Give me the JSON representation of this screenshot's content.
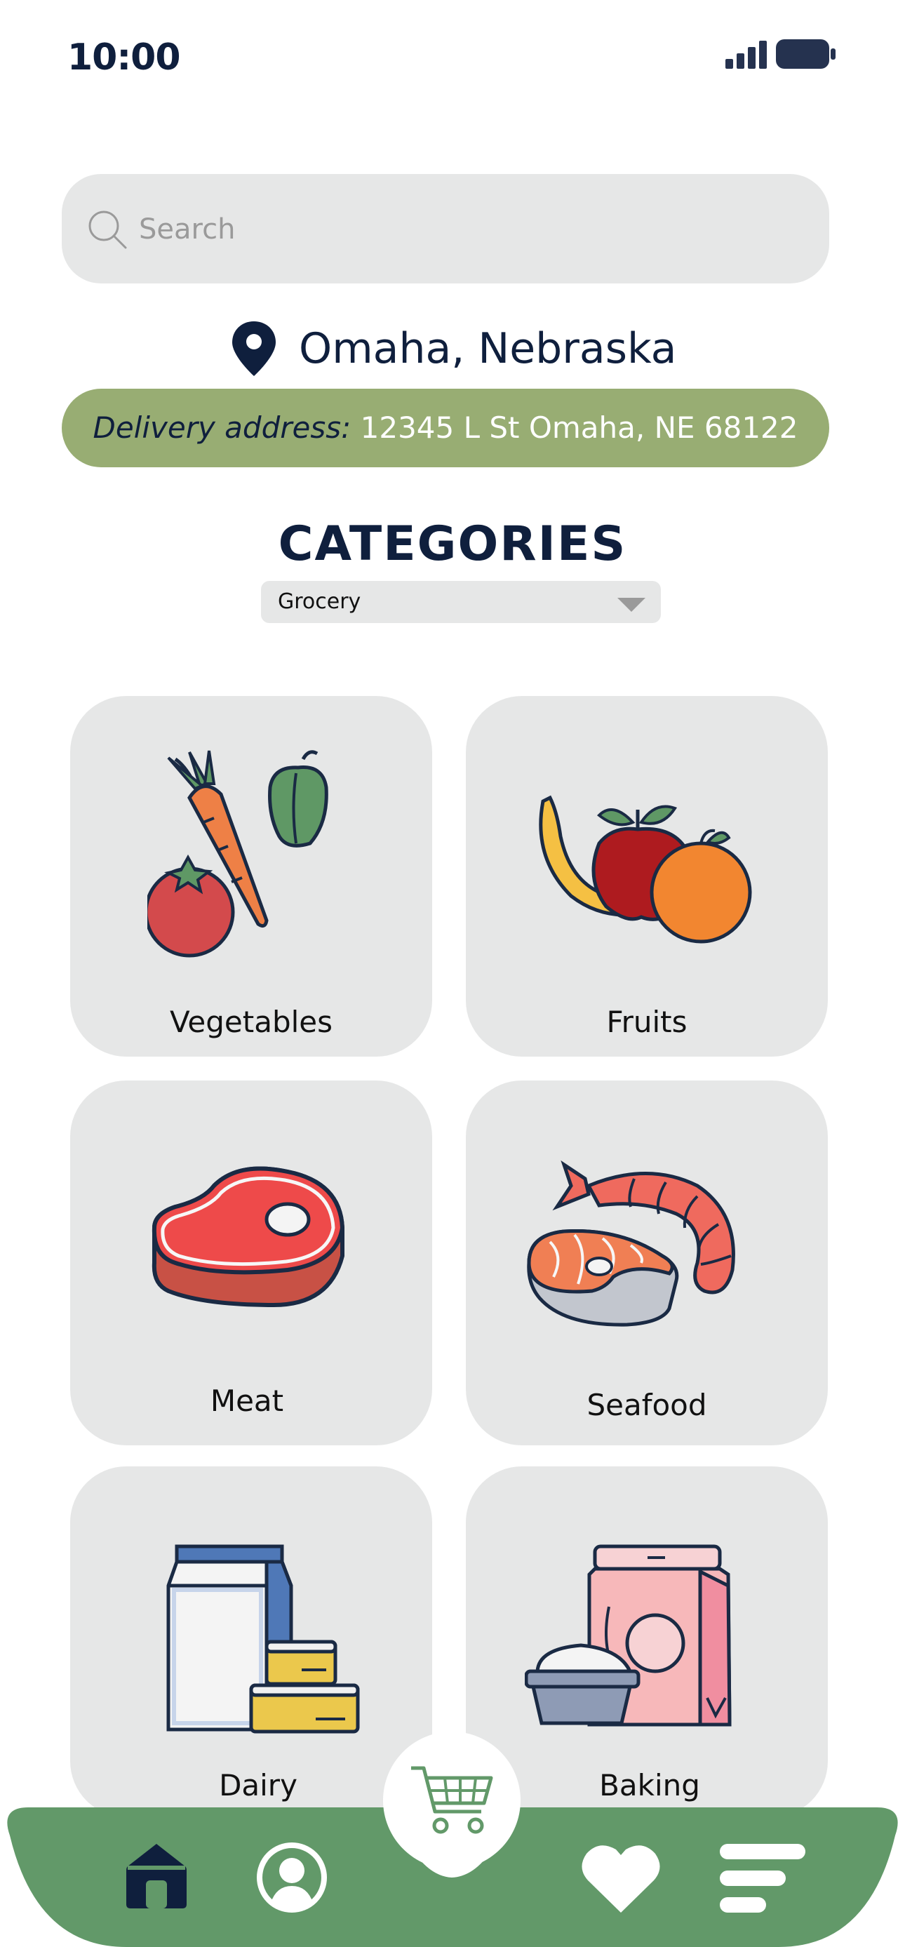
{
  "status_bar": {
    "time": "10:00"
  },
  "search": {
    "placeholder": "Search"
  },
  "location": {
    "city": "Omaha, Nebraska"
  },
  "delivery": {
    "label": "Delivery address:",
    "address": "12345 L St Omaha, NE 68122"
  },
  "categories": {
    "title": "CATEGORIES",
    "dropdown_selected": "Grocery",
    "items": [
      {
        "label": "Vegetables",
        "icon": "vegetables-icon"
      },
      {
        "label": "Fruits",
        "icon": "fruits-icon"
      },
      {
        "label": "Meat",
        "icon": "meat-icon"
      },
      {
        "label": "Seafood",
        "icon": "seafood-icon"
      },
      {
        "label": "Dairy",
        "icon": "dairy-icon"
      },
      {
        "label": "Baking",
        "icon": "baking-icon"
      }
    ]
  },
  "bottom_nav": {
    "items": [
      "home-icon",
      "profile-icon",
      "cart-icon",
      "heart-icon",
      "menu-icon"
    ]
  },
  "colors": {
    "navy": "#0f1f3d",
    "accent_green": "#98ad73",
    "nav_green": "#629969",
    "card_gray": "#e6e7e7"
  }
}
